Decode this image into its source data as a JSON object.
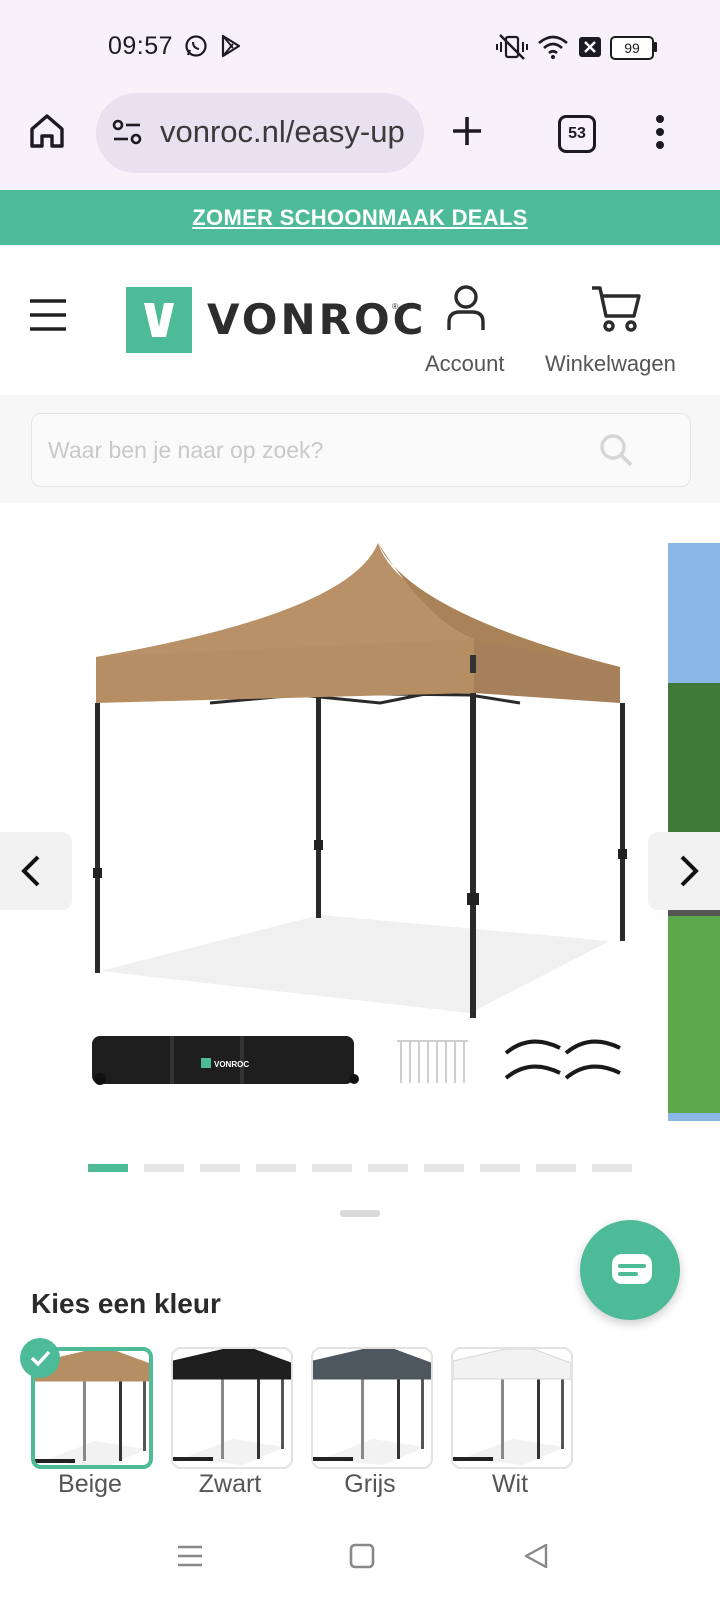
{
  "status_bar": {
    "time": "09:57",
    "battery": "99",
    "icons": [
      "whatsapp-icon",
      "play-store-icon",
      "vibrate-off-icon",
      "wifi-icon",
      "notification-x-icon",
      "battery-icon"
    ]
  },
  "browser": {
    "url": "vonroc.nl/easy-up",
    "tab_count": "53",
    "icons": [
      "home-icon",
      "site-settings-icon",
      "new-tab-icon",
      "menu-dots-icon"
    ]
  },
  "promo": {
    "label": "ZOMER SCHOONMAAK DEALS"
  },
  "header": {
    "logo_text": "VONROC",
    "account_label": "Account",
    "cart_label": "Winkelwagen"
  },
  "search": {
    "placeholder": "Waar ben je naar op zoek?"
  },
  "gallery": {
    "bag_logo": "VONROC",
    "slide_count": 10,
    "active_slide": 1
  },
  "color_picker": {
    "title": "Kies een kleur",
    "options": [
      {
        "label": "Beige",
        "color": "#b58e64",
        "selected": true
      },
      {
        "label": "Zwart",
        "color": "#1f1f1f",
        "selected": false
      },
      {
        "label": "Grijs",
        "color": "#4e5760",
        "selected": false
      },
      {
        "label": "Wit",
        "color": "#f2f2f2",
        "selected": false
      }
    ]
  },
  "colors": {
    "brand_green": "#4dbb98",
    "tent_beige": "#b58e64"
  }
}
